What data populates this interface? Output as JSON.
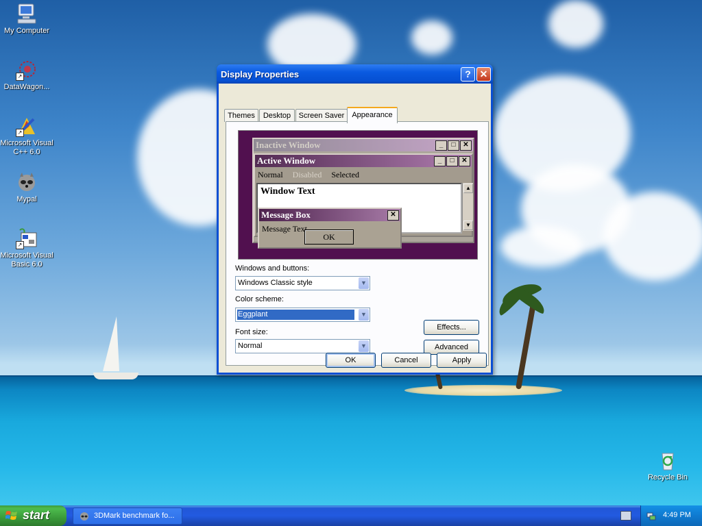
{
  "desktop": {
    "icons": [
      {
        "label": "My Computer"
      },
      {
        "label": "DataWagon..."
      },
      {
        "label": "Microsoft Visual C++ 6.0"
      },
      {
        "label": "Mypal"
      },
      {
        "label": "Microsoft Visual Basic 6.0"
      },
      {
        "label": "Recycle Bin"
      }
    ]
  },
  "dialog": {
    "title": "Display Properties",
    "help_glyph": "?",
    "close_glyph": "✕",
    "tabs": [
      {
        "label": "Themes"
      },
      {
        "label": "Desktop"
      },
      {
        "label": "Screen Saver"
      },
      {
        "label": "Appearance",
        "selected": true
      }
    ],
    "preview": {
      "inactive_title": "Inactive Window",
      "active_title": "Active Window",
      "menu": {
        "normal": "Normal",
        "disabled": "Disabled",
        "selected": "Selected"
      },
      "window_text": "Window Text",
      "message_title": "Message Box",
      "message_text": "Message Text",
      "message_ok": "OK",
      "caption_buttons": {
        "minimize": "_",
        "maximize": "□",
        "close": "✕"
      },
      "scroll_up": "▲",
      "scroll_down": "▼"
    },
    "windows_and_buttons": {
      "label": "Windows and buttons:",
      "value": "Windows Classic style"
    },
    "color_scheme": {
      "label": "Color scheme:",
      "value": "Eggplant"
    },
    "font_size": {
      "label": "Font size:",
      "value": "Normal"
    },
    "dropdown_arrow": "▼",
    "effects_label": "Effects...",
    "advanced_label": "Advanced",
    "ok_label": "OK",
    "cancel_label": "Cancel",
    "apply_label": "Apply"
  },
  "taskbar": {
    "start_label": "start",
    "task_item": "3DMark benchmark fo...",
    "clock": "4:49 PM"
  },
  "colors": {
    "xp_blue": "#0a4fd4",
    "dialog_face": "#ece9d8",
    "eggplant_desktop": "#51104f",
    "selection": "#316ac5",
    "start_green": "#3a9a3a"
  }
}
